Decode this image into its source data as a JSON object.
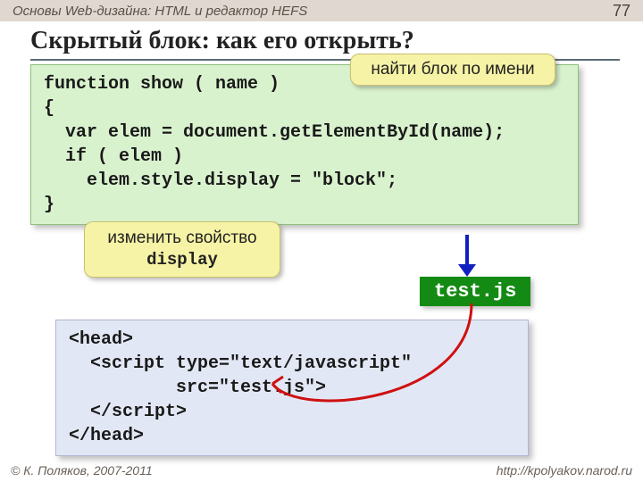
{
  "header": {
    "course": "Основы Web-дизайна: HTML и редактор HEFS",
    "page": "77"
  },
  "title": "Скрытый блок: как его открыть?",
  "code1": "function show ( name )\n{\n  var elem = document.getElementById(name);\n  if ( elem )\n    elem.style.display = \"block\";\n}",
  "callout_top": "найти блок по имени",
  "callout_mid_line1": "изменить свойство",
  "callout_mid_line2": "display",
  "file_label": "test.js",
  "code2": "<head>\n  <script type=\"text/javascript\"\n          src=\"test.js\">\n  </script>\n</head>",
  "footer": {
    "copyright": "© К. Поляков, 2007-2011",
    "url": "http://kpolyakov.narod.ru"
  }
}
